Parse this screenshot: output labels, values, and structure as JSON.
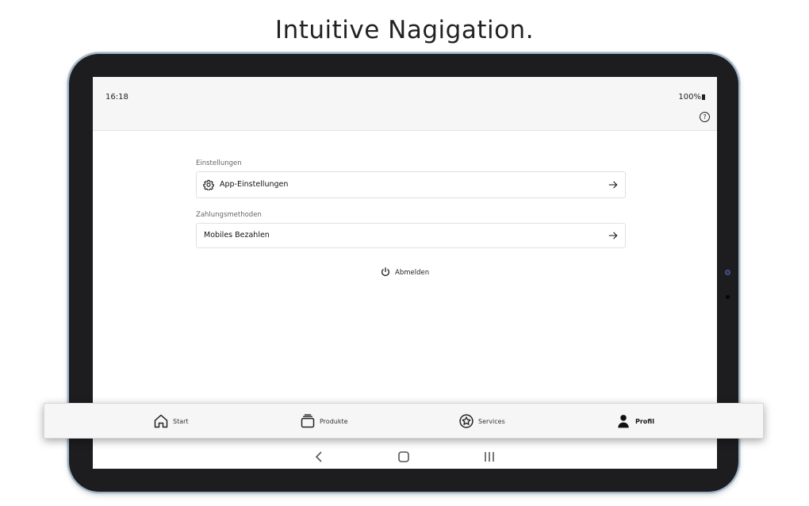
{
  "headline": "Intuitive Nagigation.",
  "status_bar": {
    "time": "16:18",
    "battery": "100%"
  },
  "settings_section": {
    "label": "Einstellungen",
    "item_label": "App-Einstellungen"
  },
  "payment_section": {
    "label": "Zahlungsmethoden",
    "item_label": "Mobiles Bezahlen"
  },
  "logout_label": "Abmelden",
  "bottom_nav": {
    "items": [
      {
        "label": "Start",
        "icon": "home-icon"
      },
      {
        "label": "Produkte",
        "icon": "products-icon"
      },
      {
        "label": "Services",
        "icon": "services-star-icon"
      },
      {
        "label": "Profil",
        "icon": "profile-icon"
      }
    ],
    "active_index": 3
  },
  "system_nav": {
    "icons": [
      "back-icon",
      "home-button-icon",
      "recents-icon"
    ]
  },
  "colors": {
    "tablet_frame": "#1d1d1f",
    "frame_edge": "#9fb3c6",
    "status_bar_bg": "#f6f6f6",
    "text": "#111111"
  }
}
